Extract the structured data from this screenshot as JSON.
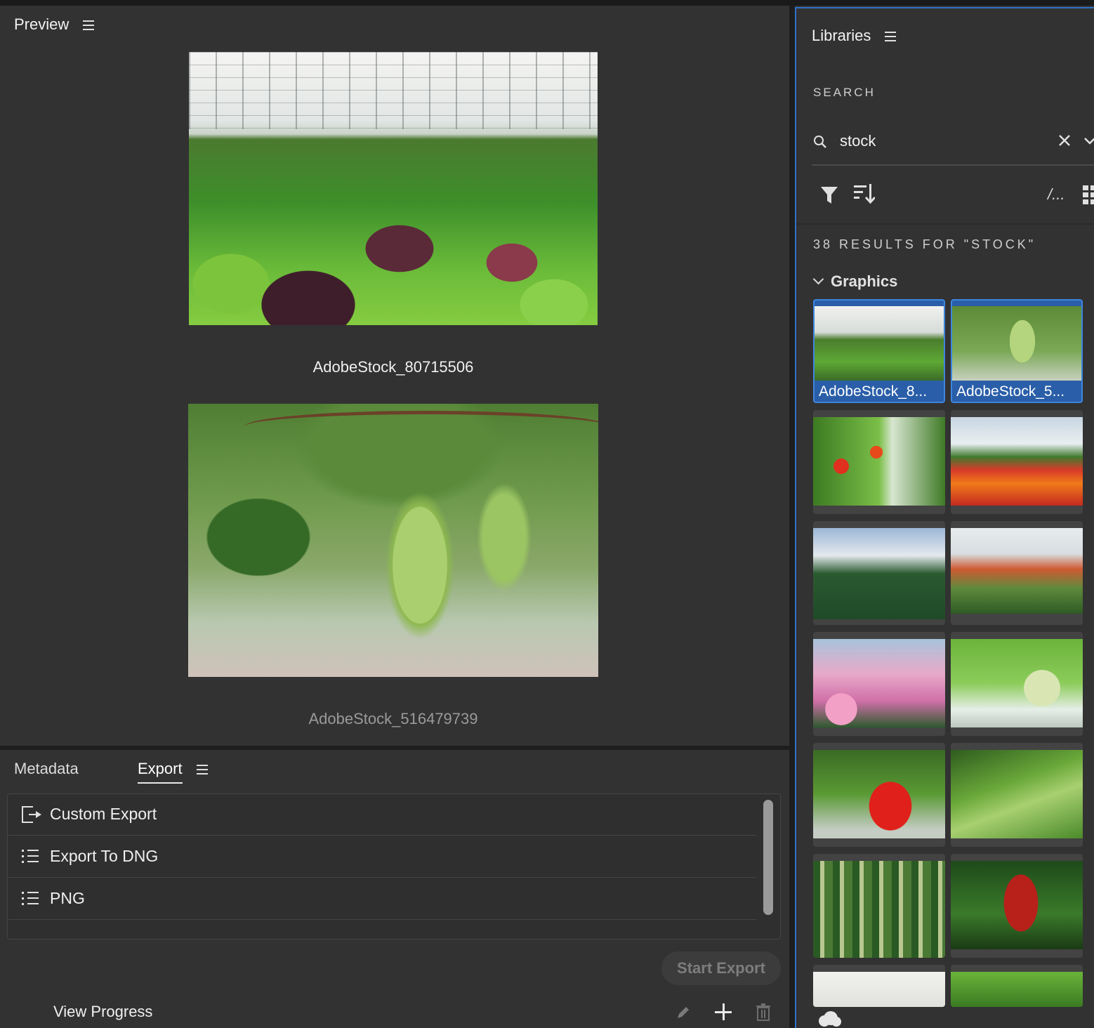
{
  "preview": {
    "title": "Preview",
    "images": [
      {
        "caption": "AdobeStock_80715506"
      },
      {
        "caption": "AdobeStock_516479739"
      }
    ]
  },
  "export_panel": {
    "tabs": [
      {
        "label": "Metadata"
      },
      {
        "label": "Export"
      }
    ],
    "presets": [
      {
        "label": "Custom Export",
        "icon": "export-icon"
      },
      {
        "label": "Export To DNG",
        "icon": "list-icon"
      },
      {
        "label": "PNG",
        "icon": "list-icon"
      }
    ],
    "start_export_label": "Start Export",
    "view_progress_label": "View Progress"
  },
  "libraries": {
    "title": "Libraries",
    "search_heading": "SEARCH",
    "search_value": "stock",
    "more_label": "/...",
    "results_count": "38 RESULTS FOR \"STOCK\"",
    "section_title": "Graphics",
    "thumbnails": [
      {
        "label": "AdobeStock_8...",
        "selected": true
      },
      {
        "label": "AdobeStock_5...",
        "selected": true
      }
    ]
  },
  "colors": {
    "panel_bg": "#323232",
    "accent": "#2d72c8",
    "text": "#e8e8e8"
  }
}
